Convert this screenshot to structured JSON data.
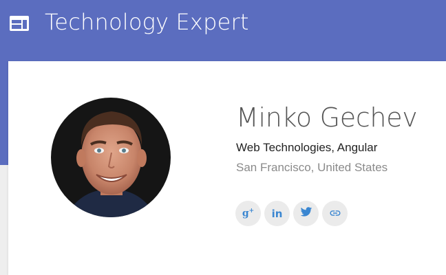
{
  "app_bar": {
    "title": "Technology Expert",
    "icon": "web-layout-icon",
    "background_color": "#5b6dbf"
  },
  "profile": {
    "name": "Minko Gechev",
    "role": "Web Technologies, Angular",
    "location": "San Francisco, United States",
    "avatar": "profile-photo"
  },
  "social_links": [
    {
      "name": "google-plus-icon",
      "label": "g+"
    },
    {
      "name": "linkedin-icon",
      "label": "in"
    },
    {
      "name": "twitter-icon"
    },
    {
      "name": "link-icon"
    }
  ],
  "colors": {
    "accent": "#3a86d1",
    "social_button_bg": "#ebebeb"
  }
}
